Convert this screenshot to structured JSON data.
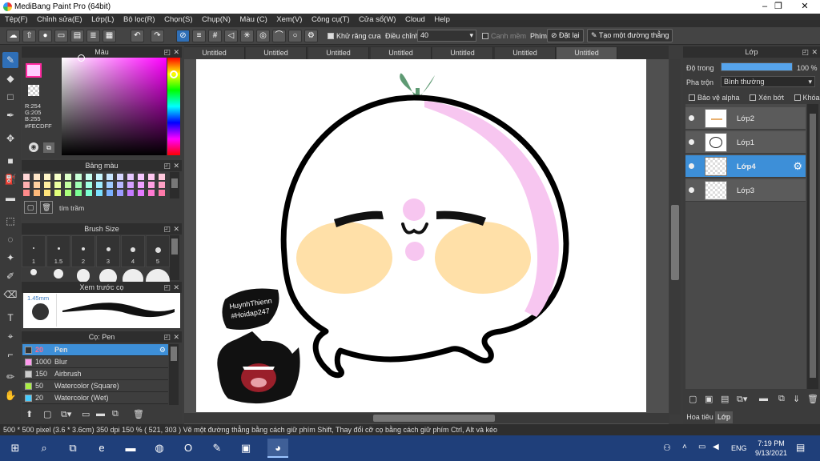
{
  "window": {
    "title": "MediBang Paint Pro (64bit)",
    "minimize": "–",
    "maximize": "❐",
    "close": "✕"
  },
  "menu": [
    "Tệp(F)",
    "Chỉnh sửa(E)",
    "Lớp(L)",
    "Bộ lọc(R)",
    "Chọn(S)",
    "Chụp(N)",
    "Màu (C)",
    "Xem(V)",
    "Công cụ(T)",
    "Cửa sổ(W)",
    "Cloud",
    "Help"
  ],
  "toolbar": {
    "antialias_label": "Khử răng cưa",
    "adjust_label": "Điều chỉnh",
    "adjust_value": "40",
    "smooth_label": "Canh mềm",
    "key_label": "Phím",
    "reset_label": "Đặt lại",
    "straight_label": "Tạo một đường thẳng"
  },
  "color_panel": {
    "title": "Màu",
    "r": "R:254",
    "g": "G:205",
    "b": "B:255",
    "hex": "#FECDFF",
    "primary_color": "#FECDFF",
    "accent": "#ff2aa0"
  },
  "palette_panel": {
    "title": "Bảng màu",
    "swatch_name": "tím trầm",
    "colors": [
      "#ffd6d6",
      "#ffe6c8",
      "#fff6c8",
      "#f6ffc8",
      "#dcffc8",
      "#c8ffd6",
      "#c8fff0",
      "#c8f6ff",
      "#c8e6ff",
      "#d6d6ff",
      "#e6c8ff",
      "#f6c8ff",
      "#ffc8f0",
      "#ffc8dc",
      "#ffb0b0",
      "#ffd1a0",
      "#ffeea0",
      "#ecffa0",
      "#c4ffa0",
      "#a0ffb4",
      "#a0ffe2",
      "#a0ecff",
      "#a0ccff",
      "#b8b8ff",
      "#d4a0ff",
      "#eea0ff",
      "#ffa0e2",
      "#ffa0c4",
      "#ff8a8a",
      "#ffba7a",
      "#ffe37a",
      "#e2ff7a",
      "#aaff7a",
      "#7aff94",
      "#7affd2",
      "#7ae0ff",
      "#7ab0ff",
      "#9c9cff",
      "#c47aff",
      "#e47aff",
      "#ff7ad2",
      "#ff7aaa"
    ]
  },
  "brush_size_panel": {
    "title": "Brush Size",
    "sizes": [
      "1",
      "1.5",
      "2",
      "3",
      "4",
      "5"
    ]
  },
  "preview_panel": {
    "title": "Xem trước cọ",
    "size": "1.45mm"
  },
  "brush_panel": {
    "title": "Cọ: Pen",
    "items": [
      {
        "size": "20",
        "name": "Pen",
        "color": "#333333"
      },
      {
        "size": "1000",
        "name": "Blur",
        "color": "#ff99ee"
      },
      {
        "size": "150",
        "name": "Airbrush",
        "color": "#cccccc"
      },
      {
        "size": "50",
        "name": "Watercolor (Square)",
        "color": "#aaee44"
      },
      {
        "size": "20",
        "name": "Watercolor (Wet)",
        "color": "#44ccff"
      }
    ]
  },
  "tabs": [
    "Untitled",
    "Untitled",
    "Untitled",
    "Untitled",
    "Untitled",
    "Untitled",
    "Untitled"
  ],
  "canvas_art": {
    "watermark_line1": "HuynhThienn",
    "watermark_line2": "#Hoidap247"
  },
  "layer_panel": {
    "title": "Lớp",
    "opacity_label": "Độ trong",
    "opacity_value": "100 %",
    "opacity": 1.0,
    "blend_label": "Pha trộn",
    "blend_value": "Bình thường",
    "protect_alpha": "Bảo vệ alpha",
    "clipping": "Xén bớt",
    "lock": "Khóa",
    "layers": [
      "Lớp2",
      "Lớp1",
      "Lớp4",
      "Lớp3"
    ],
    "bottom_tabs": [
      "Hoa tiêu",
      "Lớp"
    ]
  },
  "status": "500 * 500 pixel  (3.6 * 3.6cm)  350 dpi  150 %  ( 521, 303 )  Vẽ một đường thẳng bằng cách giữ phím Shift, Thay đổi cỡ cọ bằng cách giữ phím Ctrl, Alt và kéo",
  "taskbar": {
    "time": "7:19 PM",
    "date": "9/13/2021",
    "lang": "ENG"
  }
}
